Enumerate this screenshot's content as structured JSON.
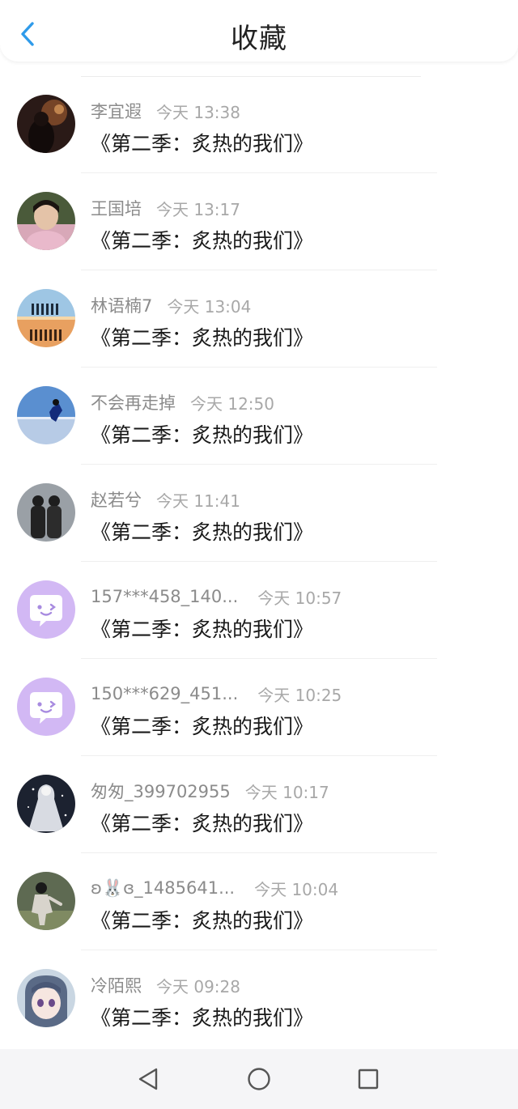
{
  "header": {
    "title": "收藏",
    "back_icon": "chevron-left-icon",
    "accent_color": "#2f9bea"
  },
  "items": [
    {
      "name": "李宜遐",
      "time": "今天 13:38",
      "content": "《第二季：炙热的我们》",
      "avatar": "photo"
    },
    {
      "name": "王国培",
      "time": "今天 13:17",
      "content": "《第二季：炙热的我们》",
      "avatar": "photo"
    },
    {
      "name": "林语楠7",
      "time": "今天 13:04",
      "content": "《第二季：炙热的我们》",
      "avatar": "photo"
    },
    {
      "name": "不会再走掉",
      "time": "今天 12:50",
      "content": "《第二季：炙热的我们》",
      "avatar": "photo"
    },
    {
      "name": "赵若兮",
      "time": "今天 11:41",
      "content": "《第二季：炙热的我们》",
      "avatar": "photo"
    },
    {
      "name": "157***458_140...",
      "time": "今天 10:57",
      "content": "《第二季：炙热的我们》",
      "avatar": "default-chat-bubble"
    },
    {
      "name": "150***629_451...",
      "time": "今天 10:25",
      "content": "《第二季：炙热的我们》",
      "avatar": "default-chat-bubble"
    },
    {
      "name": "匆匆_399702955",
      "time": "今天 10:17",
      "content": "《第二季：炙热的我们》",
      "avatar": "photo"
    },
    {
      "name": "ʚ🐰ɞ_1485641...",
      "time": "今天 10:04",
      "content": "《第二季：炙热的我们》",
      "avatar": "photo"
    },
    {
      "name": "冷陌熙",
      "time": "今天 09:28",
      "content": "《第二季：炙热的我们》",
      "avatar": "photo"
    }
  ],
  "navbar": {
    "back_icon": "triangle-back-icon",
    "home_icon": "circle-home-icon",
    "recents_icon": "square-recents-icon"
  }
}
